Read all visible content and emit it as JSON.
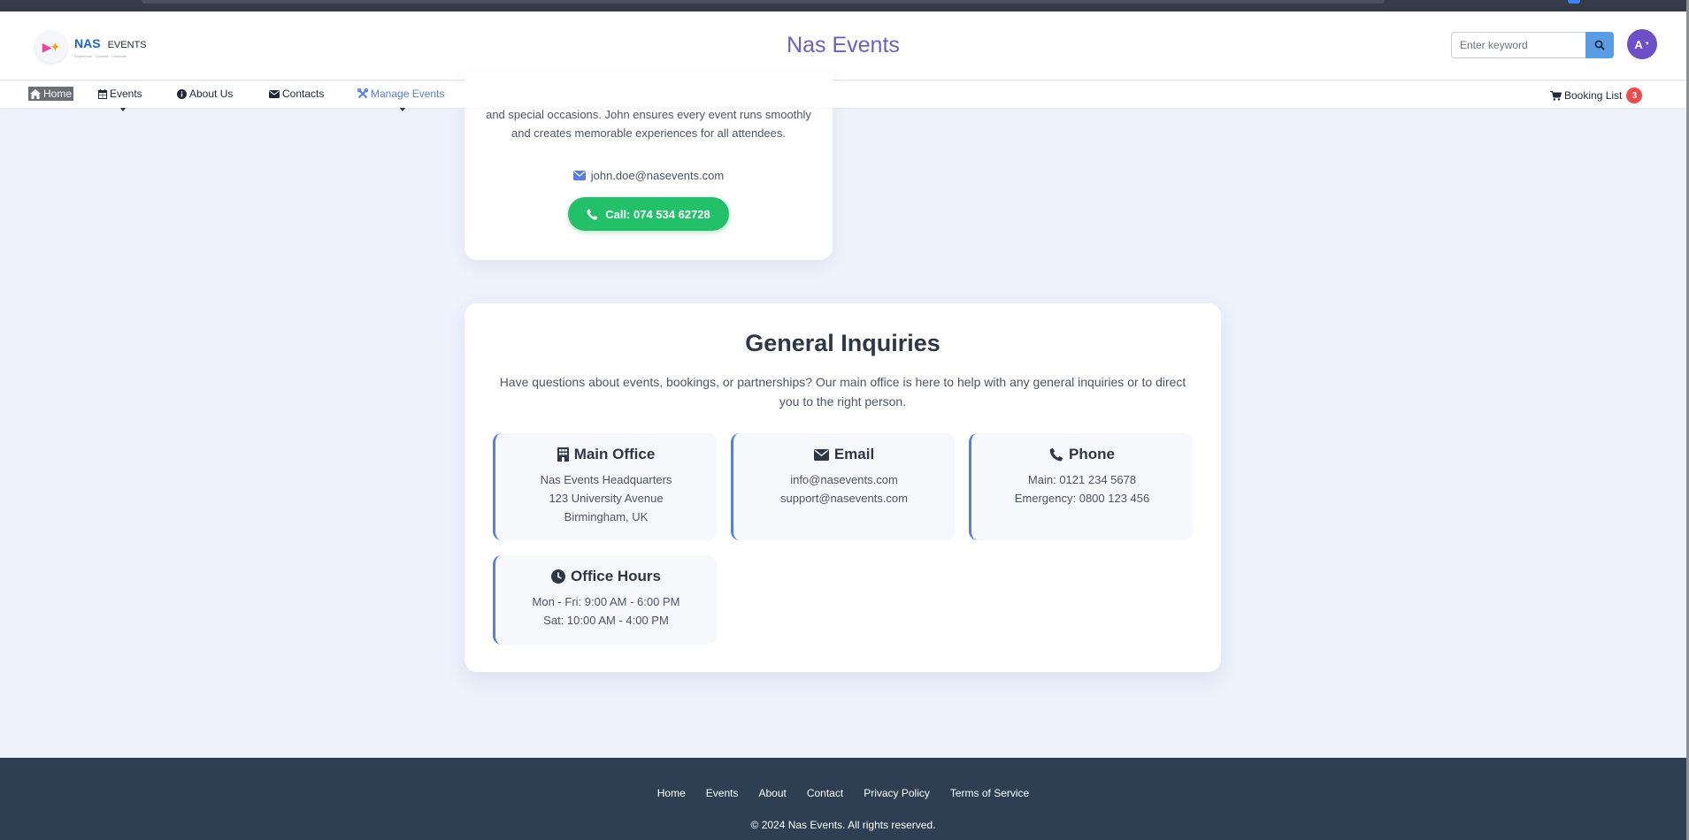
{
  "colors": {
    "brand": "#6b5fc9",
    "accent": "#5a7de0",
    "call_green": "#22c068",
    "badge_red": "#ef4b4b",
    "footer_bg": "#2e3e53"
  },
  "header": {
    "logo": {
      "brand": "NAS",
      "sub": "EVENTS",
      "tagline": "Experience · Connect · Celebrate"
    },
    "title": "Nas Events",
    "search": {
      "placeholder": "Enter keyword",
      "icon": "search-icon"
    },
    "avatar": {
      "initial": "A"
    }
  },
  "nav": {
    "items": [
      {
        "label": "Home",
        "icon": "home-icon"
      },
      {
        "label": "Events",
        "icon": "calendar-icon"
      },
      {
        "label": "About Us",
        "icon": "info-icon"
      },
      {
        "label": "Contacts",
        "icon": "envelope-icon"
      },
      {
        "label": "Manage Events",
        "icon": "tools-icon"
      }
    ],
    "booking": {
      "label": "Booking List",
      "count": "3",
      "icon": "cart-icon"
    }
  },
  "contact_card": {
    "bio_lines": [
      "and special occasions. John ensures every event runs smoothly",
      "and creates memorable experiences for all attendees."
    ],
    "email": "john.doe@nasevents.com",
    "call_label": "Call: 074 534 62728"
  },
  "inquiries": {
    "title": "General Inquiries",
    "intro": "Have questions about events, bookings, or partnerships? Our main office is here to help with any general inquiries or to direct you to the right person.",
    "boxes": [
      {
        "title": "Main Office",
        "icon": "building-icon",
        "lines": [
          "Nas Events Headquarters",
          "123 University Avenue",
          "Birmingham, UK"
        ]
      },
      {
        "title": "Email",
        "icon": "envelope-icon",
        "lines": [
          "info@nasevents.com",
          "support@nasevents.com"
        ]
      },
      {
        "title": "Phone",
        "icon": "phone-icon",
        "lines": [
          "Main: 0121 234 5678",
          "Emergency: 0800 123 456"
        ]
      },
      {
        "title": "Office Hours",
        "icon": "clock-icon",
        "lines": [
          "Mon - Fri: 9:00 AM - 6:00 PM",
          "Sat: 10:00 AM - 4:00 PM"
        ]
      }
    ]
  },
  "footer": {
    "links": [
      "Home",
      "Events",
      "About",
      "Contact",
      "Privacy Policy",
      "Terms of Service"
    ],
    "copyright": "© 2024 Nas Events. All rights reserved."
  }
}
